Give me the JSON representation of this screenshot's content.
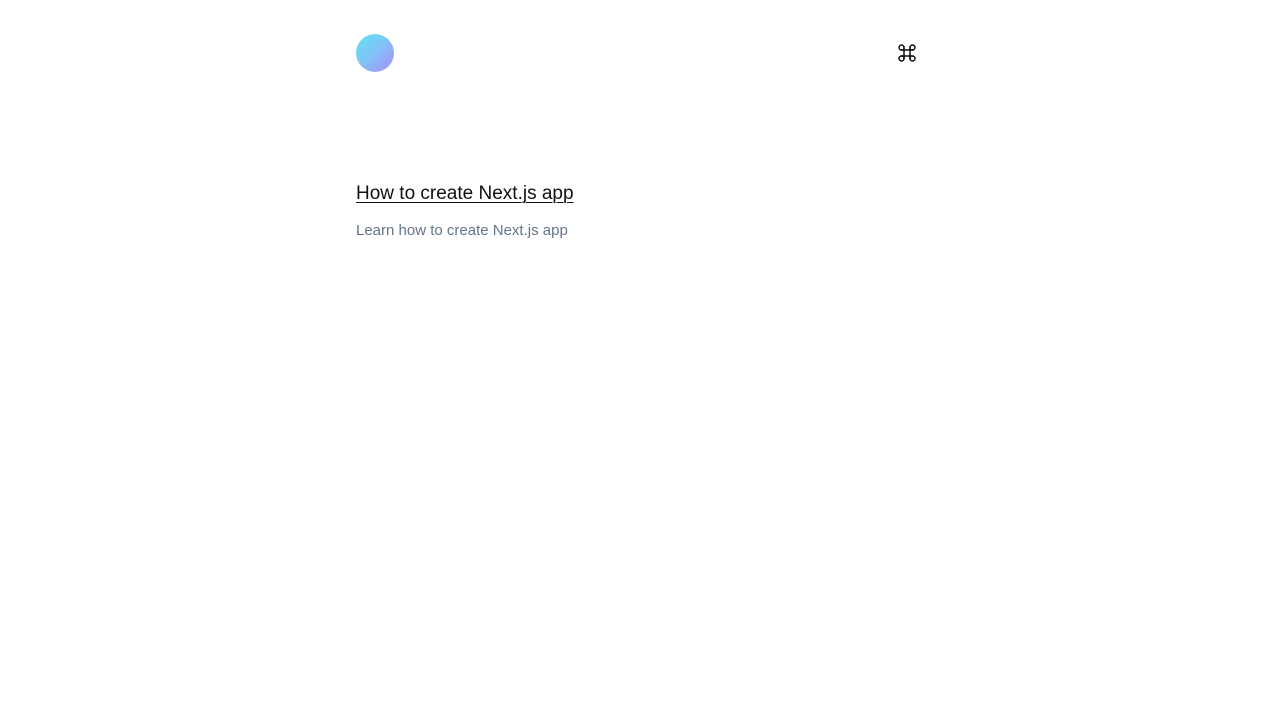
{
  "header": {
    "avatar_icon": "gradient-avatar",
    "command_icon": "command-key-icon"
  },
  "posts": [
    {
      "title": "How to create Next.js app",
      "description": "Learn how to create Next.js app"
    }
  ],
  "colors": {
    "background": "#ffffff",
    "title": "#111111",
    "description": "#64748b",
    "avatar_gradient_start": "#5fe3f2",
    "avatar_gradient_end": "#a98bf5"
  }
}
